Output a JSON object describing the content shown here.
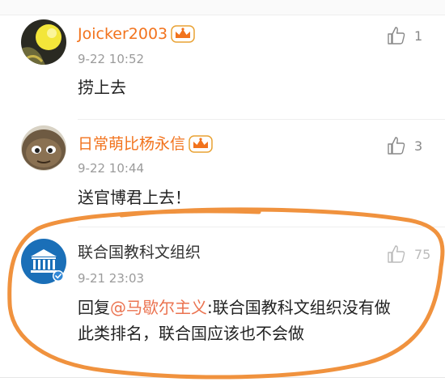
{
  "comments": [
    {
      "author": "Joicker2003",
      "timestamp": "9-22 10:52",
      "text": "捞上去",
      "likes": "1",
      "vip": true,
      "avatar_icon": "yellow-ball-avatar"
    },
    {
      "author": "日常萌比杨永信",
      "timestamp": "9-22 10:44",
      "text": "送官博君上去！",
      "likes": "3",
      "vip": true,
      "avatar_icon": "cartoon-face-avatar"
    },
    {
      "author": "联合国教科文组织",
      "timestamp": "9-21 23:03",
      "reply_prefix": "回复",
      "mention": "@马歇尔主义",
      "reply_line1": ":联合国教科文组织没有做",
      "reply_line2": "此类排名，联合国应该也不会做",
      "likes": "75",
      "vip": false,
      "verified": true,
      "avatar_icon": "unesco-temple-logo"
    }
  ],
  "colors": {
    "vip_name": "#f2731d",
    "mention": "#eb7350",
    "highlight_oval": "#f0923e",
    "timestamp": "#9b9b9b"
  }
}
